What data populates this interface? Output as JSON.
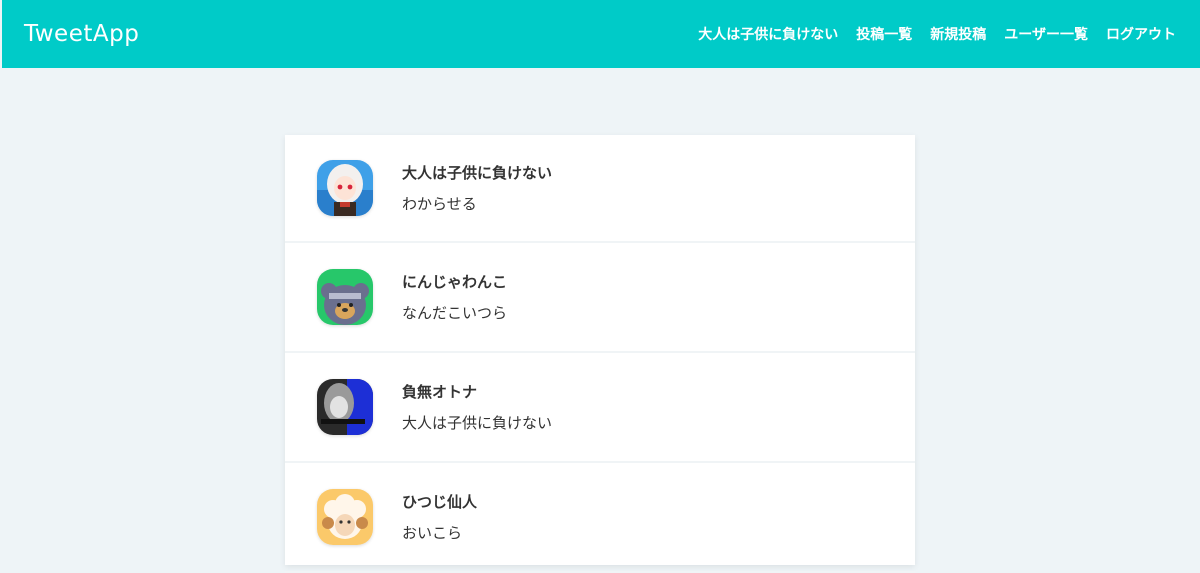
{
  "header": {
    "logo": "TweetApp",
    "nav": [
      "大人は子供に負けない",
      "投稿一覧",
      "新規投稿",
      "ユーザー一覧",
      "ログアウト"
    ]
  },
  "posts": [
    {
      "name": "大人は子供に負けない",
      "text": "わからせる",
      "avatar": "anime-girl-avatar"
    },
    {
      "name": "にんじゃわんこ",
      "text": "なんだこいつら",
      "avatar": "ninja-dog-avatar"
    },
    {
      "name": "負無オトナ",
      "text": "大人は子供に負けない",
      "avatar": "dark-anime-avatar"
    },
    {
      "name": "ひつじ仙人",
      "text": "おいこら",
      "avatar": "sheep-avatar"
    }
  ]
}
